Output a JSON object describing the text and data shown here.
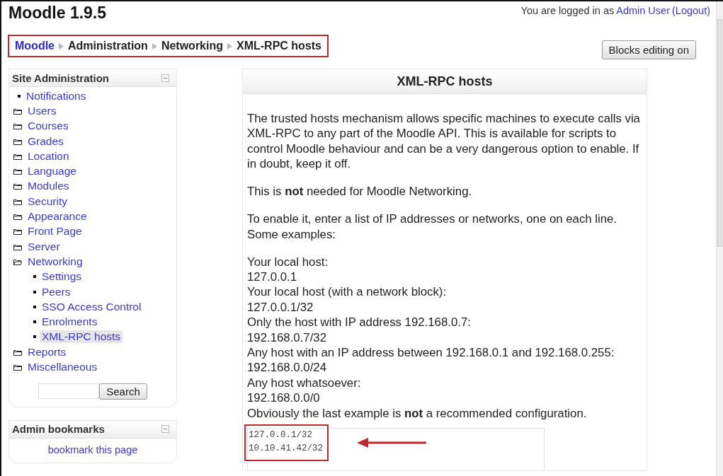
{
  "header": {
    "site_title": "Moodle 1.9.5",
    "login_prefix": "You are logged in as",
    "user_link": "Admin User",
    "logout_link": "(Logout)"
  },
  "breadcrumb": {
    "highlighted": true,
    "items": [
      {
        "label": "Moodle",
        "kind": "link"
      },
      {
        "label": "Administration",
        "kind": "text"
      },
      {
        "label": "Networking",
        "kind": "text"
      },
      {
        "label": "XML-RPC hosts",
        "kind": "text"
      }
    ]
  },
  "editing_button": "Blocks editing on",
  "site_admin_block": {
    "title": "Site Administration",
    "items": [
      {
        "label": "Notifications",
        "kind": "leaf",
        "selected": false
      },
      {
        "label": "Users",
        "kind": "folder",
        "expanded": false
      },
      {
        "label": "Courses",
        "kind": "folder",
        "expanded": false
      },
      {
        "label": "Grades",
        "kind": "folder",
        "expanded": false
      },
      {
        "label": "Location",
        "kind": "folder",
        "expanded": false
      },
      {
        "label": "Language",
        "kind": "folder",
        "expanded": false
      },
      {
        "label": "Modules",
        "kind": "folder",
        "expanded": false
      },
      {
        "label": "Security",
        "kind": "folder",
        "expanded": false
      },
      {
        "label": "Appearance",
        "kind": "folder",
        "expanded": false
      },
      {
        "label": "Front Page",
        "kind": "folder",
        "expanded": false
      },
      {
        "label": "Server",
        "kind": "folder",
        "expanded": false
      },
      {
        "label": "Networking",
        "kind": "folder",
        "expanded": true,
        "children": [
          {
            "label": "Settings",
            "kind": "leaf",
            "selected": false
          },
          {
            "label": "Peers",
            "kind": "leaf",
            "selected": false
          },
          {
            "label": "SSO Access Control",
            "kind": "leaf",
            "selected": false
          },
          {
            "label": "Enrolments",
            "kind": "leaf",
            "selected": false
          },
          {
            "label": "XML-RPC hosts",
            "kind": "leaf",
            "selected": true
          }
        ]
      },
      {
        "label": "Reports",
        "kind": "folder",
        "expanded": false
      },
      {
        "label": "Miscellaneous",
        "kind": "folder",
        "expanded": false
      }
    ],
    "search_button": "Search"
  },
  "bookmarks_block": {
    "title": "Admin bookmarks",
    "link": "bookmark this page"
  },
  "main": {
    "title": "XML-RPC hosts",
    "paragraphs": [
      "The trusted hosts mechanism allows specific machines to execute calls via XML-RPC to any part of the Moodle API. This is available for scripts to control Moodle behaviour and can be a very dangerous option to enable. If in doubt, keep it off.",
      "This is **not** needed for Moodle Networking.",
      "To enable it, enter a list of IP addresses or networks, one on each line. Some examples:"
    ],
    "examples": [
      "Your local host:",
      "127.0.0.1",
      "Your local host (with a network block):",
      "127.0.0.1/32",
      "Only the host with IP address 192.168.0.7:",
      "192.168.0.7/32",
      "Any host with an IP address between 192.168.0.1 and 192.168.0.255:",
      "192.168.0.0/24",
      "Any host whatsoever:",
      "192.168.0.0/0",
      "Obviously the last example is **not** a recommended configuration."
    ],
    "hosts_field": {
      "lines": [
        "127.0.0.1/32",
        "10.10.41.42/32"
      ],
      "highlighted": true,
      "arrow": true
    }
  }
}
